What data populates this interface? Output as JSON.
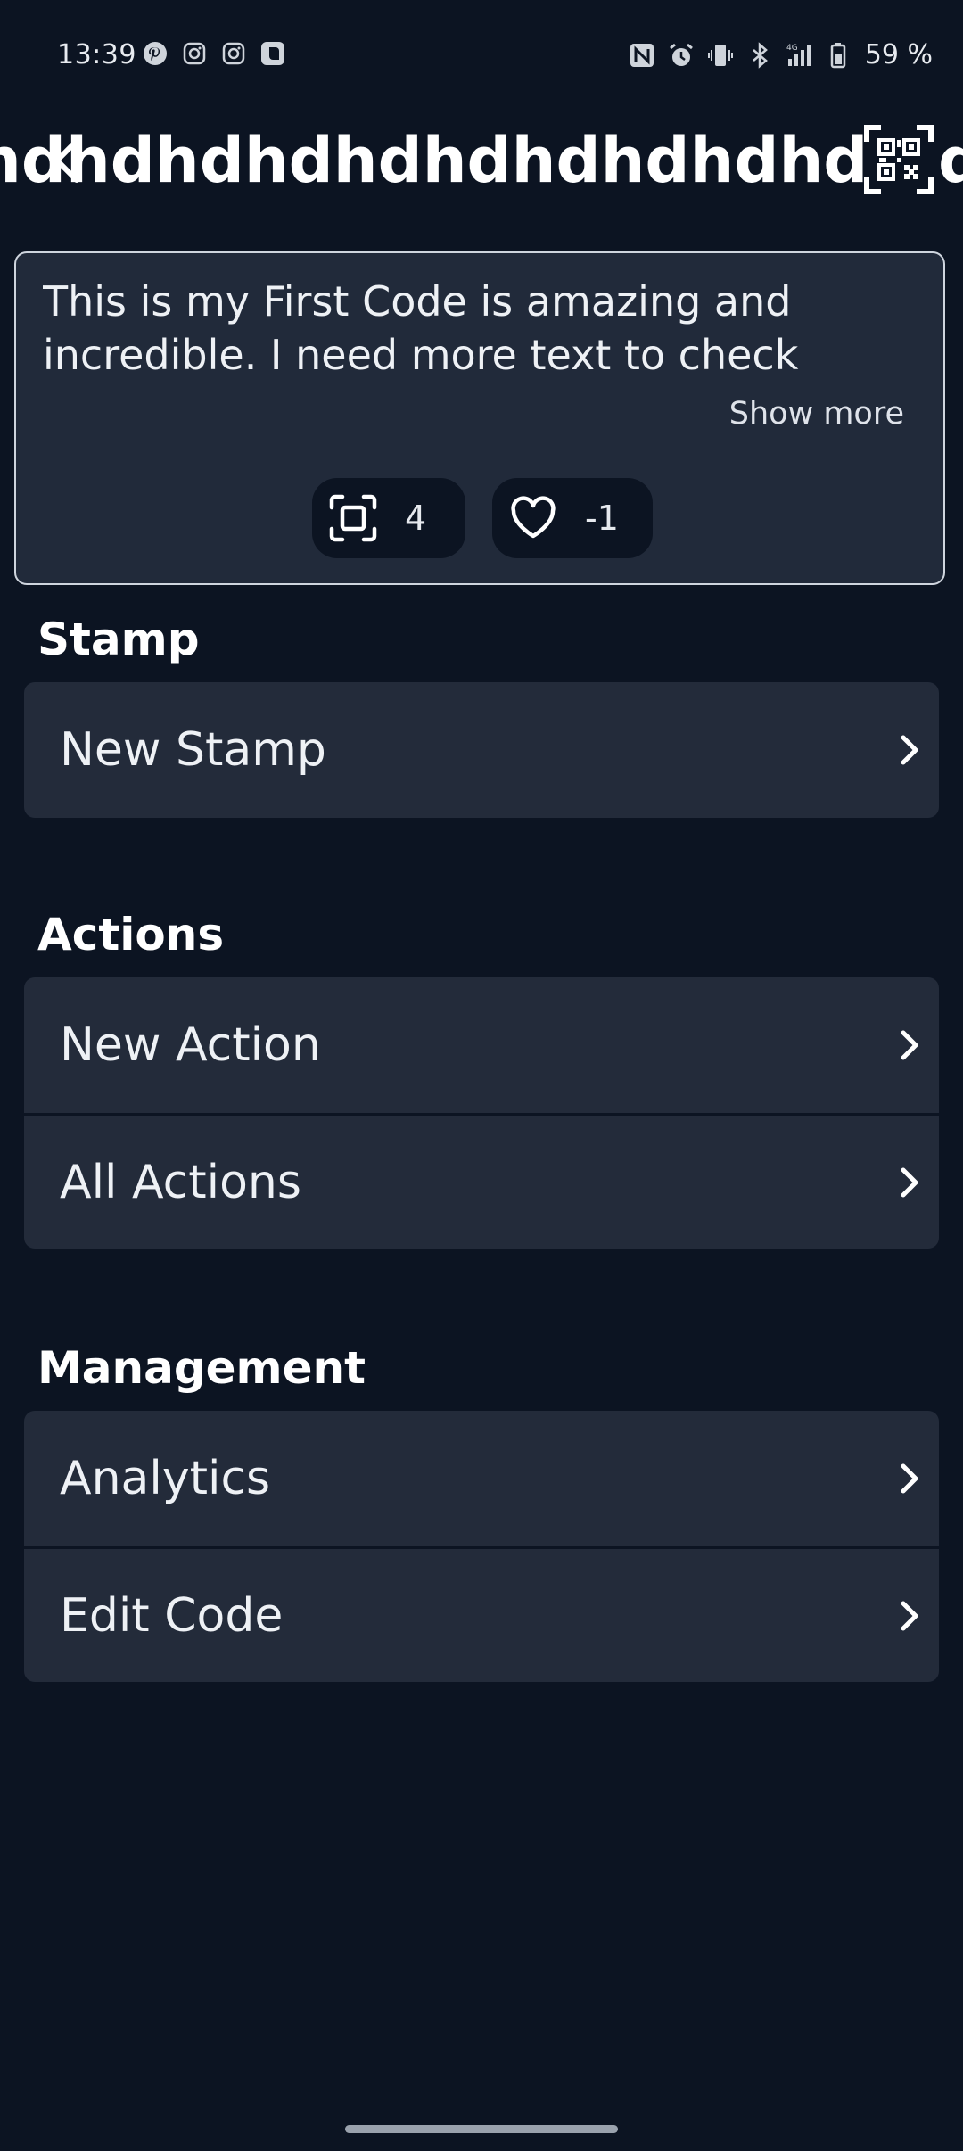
{
  "status_bar": {
    "time": "13:39",
    "left_icons": [
      "pinterest-icon",
      "instagram-icon",
      "instagram-icon",
      "app-icon"
    ],
    "right_icons": [
      "nfc-icon",
      "alarm-icon",
      "vibrate-icon",
      "bluetooth-icon",
      "signal-4g-icon",
      "battery-icon"
    ],
    "battery": "59 %"
  },
  "header": {
    "title": "hdhdhdhdhdhdhdhdhdhdhdhdhdh",
    "trailing": "d"
  },
  "description": {
    "text": "This is my First Code is amazing and incredible. I need more text to check some ...",
    "show_more": "Show more",
    "scans": "4",
    "likes": "-1"
  },
  "sections": {
    "stamp": {
      "title": "Stamp",
      "items": [
        "New Stamp"
      ]
    },
    "actions": {
      "title": "Actions",
      "items": [
        "New Action",
        "All Actions"
      ]
    },
    "management": {
      "title": "Management",
      "items": [
        "Analytics",
        "Edit Code"
      ]
    }
  },
  "colors": {
    "background": "#0c1422",
    "card": "#232b3a",
    "text": "#ffffff"
  }
}
